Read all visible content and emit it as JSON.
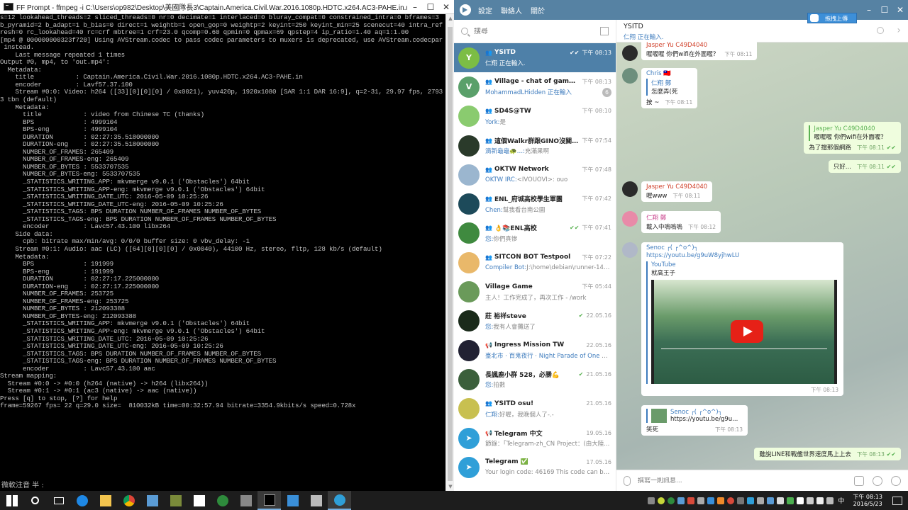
{
  "console": {
    "title": "FF Prompt - ffmpeg  -i C:\\Users\\op982\\Desktop\\美國隊長3\\Captain.America.Civil.War.2016.1080p.HDTC.x264.AC3-PAHE.in.mkv out.mp4",
    "lines_a": "s=12 lookahead_threads=2 sliced_threads=0 nr=0 decimate=1 interlaced=0 bluray_compat=0 constrained_intra=0 bframes=3\nb_pyramid=2 b_adapt=1 b_bias=0 direct=1 weightb=1 open_gop=0 weightp=2 keyint=250 keyint_min=25 scenecut=40 intra_ref\nresh=0 rc_lookahead=40 rc=crf mbtree=1 crf=23.0 qcomp=0.60 qpmin=0 qpmax=69 qpstep=4 ip_ratio=1.40 aq=1:1.00",
    "warn_line": "[mp4 @ 000000000323f720] Using AVStream.codec to pass codec parameters to muxers is deprecated, use AVStream.codecpar\n instead.",
    "lines_b": "    Last message repeated 1 times\nOutput #0, mp4, to 'out.mp4':\n  Metadata:\n    title           : Captain.America.Civil.War.2016.1080p.HDTC.x264.AC3-PAHE.in\n    encoder         : Lavf57.37.100\n    Stream #0:0: Video: h264 ([33][0][0][0] / 0x0021), yuv420p, 1920x1080 [SAR 1:1 DAR 16:9], q=2-31, 29.97 fps, 2793\n3 tbn (default)\n    Metadata:\n      title           : video from Chinese TC (thanks)\n      BPS             : 4999104\n      BPS-eng         : 4999104\n      DURATION        : 02:27:35.518000000\n      DURATION-eng    : 02:27:35.518000000\n      NUMBER_OF_FRAMES: 265409\n      NUMBER_OF_FRAMES-eng: 265409\n      NUMBER_OF_BYTES : 5533707535\n      NUMBER_OF_BYTES-eng: 5533707535\n      _STATISTICS_WRITING_APP: mkvmerge v9.0.1 ('Obstacles') 64bit\n      _STATISTICS_WRITING_APP-eng: mkvmerge v9.0.1 ('Obstacles') 64bit\n      _STATISTICS_WRITING_DATE_UTC: 2016-05-09 10:25:26\n      _STATISTICS_WRITING_DATE_UTC-eng: 2016-05-09 10:25:26\n      _STATISTICS_TAGS: BPS DURATION NUMBER_OF_FRAMES NUMBER_OF_BYTES\n      _STATISTICS_TAGS-eng: BPS DURATION NUMBER_OF_FRAMES NUMBER_OF_BYTES\n      encoder         : Lavc57.43.100 libx264\n    Side data:\n      cpb: bitrate max/min/avg: 0/0/0 buffer size: 0 vbv_delay: -1\n    Stream #0:1: Audio: aac (LC) ([64][0][0][0] / 0x0040), 44100 Hz, stereo, fltp, 128 kb/s (default)\n    Metadata:\n      BPS             : 191999\n      BPS-eng         : 191999\n      DURATION        : 02:27:17.225000000\n      DURATION-eng    : 02:27:17.225000000\n      NUMBER_OF_FRAMES: 253725\n      NUMBER_OF_FRAMES-eng: 253725\n      NUMBER_OF_BYTES : 212093388\n      NUMBER_OF_BYTES-eng: 212093388\n      _STATISTICS_WRITING_APP: mkvmerge v9.0.1 ('Obstacles') 64bit\n      _STATISTICS_WRITING_APP-eng: mkvmerge v9.0.1 ('Obstacles') 64bit\n      _STATISTICS_WRITING_DATE_UTC: 2016-05-09 10:25:26\n      _STATISTICS_WRITING_DATE_UTC-eng: 2016-05-09 10:25:26\n      _STATISTICS_TAGS: BPS DURATION NUMBER_OF_FRAMES NUMBER_OF_BYTES\n      _STATISTICS_TAGS-eng: BPS DURATION NUMBER_OF_FRAMES NUMBER_OF_BYTES\n      encoder         : Lavc57.43.100 aac\nStream mapping:\n  Stream #0:0 -> #0:0 (h264 (native) -> h264 (libx264))\n  Stream #0:1 -> #0:1 (ac3 (native) -> aac (native))\nPress [q] to stop, [?] for help\nframe=59267 fps= 22 q=29.0 size=  810032kB time=00:32:57.94 bitrate=3354.9kbits/s speed=0.728x",
    "ime_status": "微軟注音 半 :"
  },
  "telegram": {
    "menu": [
      "設定",
      "聯絡人",
      "關於"
    ],
    "search_placeholder": "搜尋",
    "upload_button": "拖拽上傳",
    "chats": [
      {
        "kind": "group",
        "name": "YSITD",
        "time": "下午 08:13",
        "check": "✔✔",
        "who": "",
        "preview": "仁翔 正在輸入.",
        "avatar_color": "#7cbd45",
        "avatar_text": "Y",
        "active": true
      },
      {
        "kind": "group",
        "name": "Village - chat of game @Vil...",
        "time": "下午 08:13",
        "check": "",
        "who": "MohammadLHidden 正在輸入",
        "preview": "",
        "badge": "6",
        "avatar_color": "#5aa06a",
        "avatar_text": "V"
      },
      {
        "kind": "group",
        "name": "SD4S@TW",
        "time": "下午 08:10",
        "check": "",
        "who": "York:",
        "preview": "是",
        "avatar_color": "#8acb6f",
        "avatar_text": ""
      },
      {
        "kind": "group",
        "name": "這個Walkr群跟GINO沒關喔 ...",
        "time": "下午 07:54",
        "check": "",
        "who": "滴新龜龜🐢…:",
        "preview": "充滿果啊",
        "avatar_color": "#2a3a2a",
        "avatar_text": ""
      },
      {
        "kind": "group",
        "name": "OKTW Network",
        "time": "下午 07:48",
        "check": "",
        "who": "OKTW IRC:",
        "preview": "<IVOUOVI>: ouo",
        "avatar_color": "#9bb6cf",
        "avatar_text": ""
      },
      {
        "kind": "group",
        "name": "ENL_府城高校學生軍團",
        "time": "下午 07:42",
        "check": "",
        "who": "Chen:",
        "preview": "幫我看台南公園",
        "avatar_color": "#1d4a5a",
        "avatar_text": ""
      },
      {
        "kind": "group",
        "name": "👌📚ENL高校",
        "time": "下午 07:41",
        "check": "✔✔",
        "who": "您:",
        "preview": "你們真慘",
        "avatar_color": "#3f8a3f",
        "avatar_text": ""
      },
      {
        "kind": "group",
        "name": "SITCON BOT Testpool",
        "time": "下午 07:22",
        "check": "",
        "who": "Compiler Bot:",
        "preview": "J:\\home\\debian\\runner-146...",
        "avatar_color": "#e9b86a",
        "avatar_text": ""
      },
      {
        "kind": "user",
        "name": "Village Game",
        "time": "下午 05:44",
        "check": "",
        "who": "",
        "preview": "主人！工作完成了，再次工作 - /work",
        "avatar_color": "#6a9a5a",
        "avatar_text": ""
      },
      {
        "kind": "user",
        "name": "莊 裕祥steve",
        "time": "22.05.16",
        "check": "✔",
        "who": "您:",
        "preview": "我有人會攤送了",
        "avatar_color": "#1a2a1a",
        "avatar_text": ""
      },
      {
        "kind": "channel",
        "name": "Ingress Mission TW",
        "time": "22.05.16",
        "check": "",
        "who": "臺北市 · 百鬼夜行 · Night Parade of One Hu...",
        "preview": "",
        "avatar_color": "#223",
        "avatar_text": ""
      },
      {
        "kind": "user",
        "name": "長諷鹿小群 528，必勝💪",
        "time": "21.05.16",
        "check": "✔",
        "who": "您:",
        "preview": "拍數",
        "avatar_color": "#3b5f3b",
        "avatar_text": ""
      },
      {
        "kind": "group",
        "name": "YSITD osu!",
        "time": "21.05.16",
        "check": "",
        "who": "仁翔:",
        "preview": "好喔，我晚個人了-.-",
        "avatar_color": "#c8c050",
        "avatar_text": ""
      },
      {
        "kind": "channel",
        "name": "Telegram 中文",
        "time": "19.05.16",
        "check": "",
        "who": "",
        "preview": "節錄：「Telegram-zh_CN Project：(由大陸...",
        "avatar_color": "#2f9fd8",
        "avatar_text": "➤"
      },
      {
        "kind": "user",
        "name": "Telegram ✅",
        "time": "17.05.16",
        "check": "",
        "who": "",
        "preview": "Your login code: 46169  This code can be us...",
        "avatar_color": "#2f9fd8",
        "avatar_text": "➤"
      }
    ],
    "chat_title": "YSITD",
    "chat_status": "仁翔 正在輸入.",
    "messages": {
      "m1_sender": "Jasper Yu C49D4040",
      "m1_text": "喔喔喔 你們wifi在外面喔？",
      "m1_time": "下午 08:11",
      "m2_sender": "Chris 🇹🇼",
      "m2_reply_name": "仁翔 鄭",
      "m2_reply_text": "怎麼弄(死",
      "m2_text": "按 ~",
      "m2_time": "下午 08:11",
      "m3_reply_name": "Jasper Yu C49D4040",
      "m3_reply_text": "喔喔喔 你們wifi在外面喔？",
      "m3_text": "為了擋那個網路",
      "m3_time": "下午 08:11",
      "m4_text": "只好...",
      "m4_time": "下午 08:11",
      "m5_sender": "Jasper Yu C49D4040",
      "m5_text": "喔www",
      "m5_time": "下午 08:11",
      "m6_sender": "仁翔 鄭",
      "m6_text": "載入中嗚嗚嗚",
      "m6_time": "下午 08:12",
      "m7_sender": "Senoc ┌( ┌^o^)┐",
      "m7_link": "https://youtu.be/g9uW8yjhwLU",
      "m7_site": "YouTube",
      "m7_desc": "就高王子",
      "m7_time": "下午 08:13",
      "m8_reply_name": "Senoc ┌( ┌^o^)┐",
      "m8_reply_text": "https://youtu.be/g9u...",
      "m8_text": "笑死",
      "m8_time": "下午 08:13",
      "m9_text": "雖說LINE和戰艦世界速度馬上上去",
      "m9_time": "下午 08:13"
    },
    "composer_placeholder": "撰寫一則訊息..."
  },
  "taskbar": {
    "clock_time": "下午 08:13",
    "clock_date": "2016/5/23",
    "ime": "中"
  }
}
